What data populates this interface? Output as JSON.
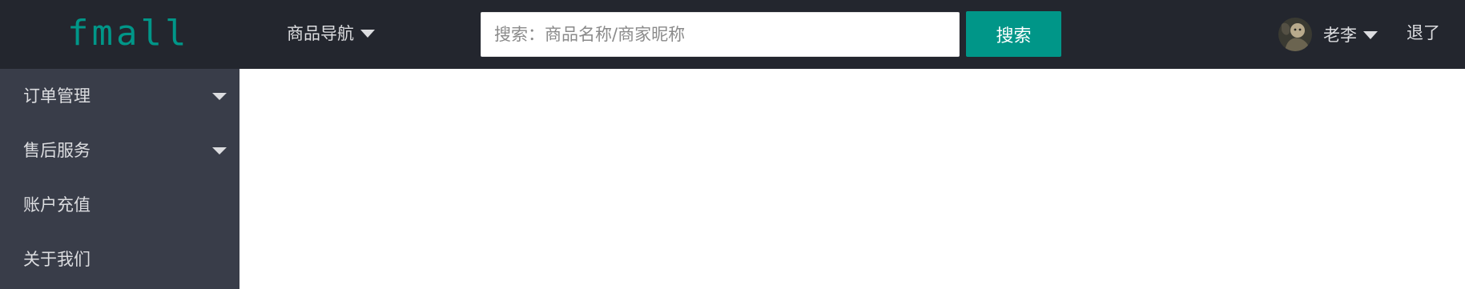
{
  "header": {
    "logo": "fmall",
    "nav_menu_label": "商品导航",
    "search": {
      "placeholder": "搜索：商品名称/商家昵称",
      "value": "",
      "button_label": "搜索"
    },
    "user": {
      "name": "老李"
    },
    "logout_label": "退了"
  },
  "sidebar": {
    "items": [
      {
        "label": "订单管理",
        "has_submenu": true
      },
      {
        "label": "售后服务",
        "has_submenu": true
      },
      {
        "label": "账户充值",
        "has_submenu": false
      },
      {
        "label": "关于我们",
        "has_submenu": false
      }
    ]
  },
  "colors": {
    "header_bg": "#23262e",
    "sidebar_bg": "#393d49",
    "accent": "#009688"
  },
  "icons": {
    "nav_caret": "caret-down-icon",
    "user_caret": "caret-down-icon",
    "avatar": "user-avatar"
  }
}
